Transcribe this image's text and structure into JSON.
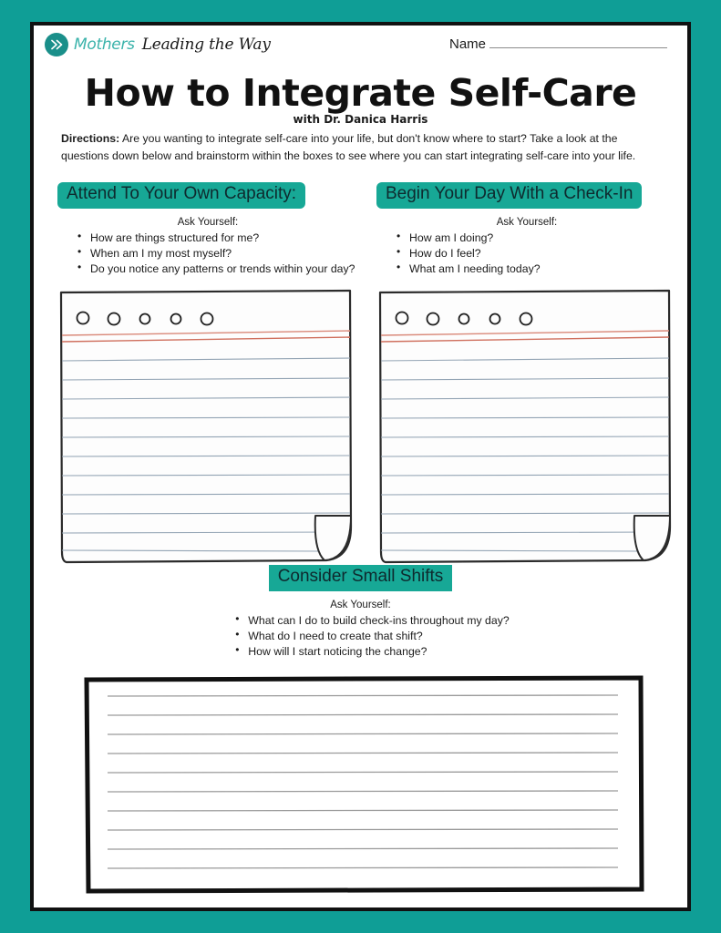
{
  "page": {
    "border_color": "#0f9e96",
    "accent_color": "#17a896",
    "text_color": "#1b1b1b"
  },
  "brand": {
    "logo_icon": "double-chevron-right-icon",
    "word_1": "Mothers",
    "word_2": "Leading the Way",
    "word_1_color": "#3bb3ab",
    "word_2_color": "#1b1b1b"
  },
  "name_field": {
    "label": "Name",
    "value": ""
  },
  "header": {
    "title": "How to Integrate Self-Care",
    "subtitle": "with Dr. Danica Harris"
  },
  "directions": {
    "label": "Directions:",
    "body": " Are you wanting to integrate self-care into your life, but don't know where to start? Take a look at the questions down below and brainstorm within the boxes to see where you can start integrating self-care into your life."
  },
  "sections": [
    {
      "id": "attend-to-your-own-capacity",
      "heading": "Attend To Your Own Capacity:",
      "ask_label": "Ask Yourself:",
      "questions": [
        "How are things structured for me?",
        "When am I my most myself?",
        "Do you notice any patterns or trends within your day?"
      ]
    },
    {
      "id": "begin-your-day-with-a-check-in",
      "heading": "Begin Your Day With a Check-In",
      "ask_label": "Ask Yourself:",
      "questions": [
        "How am I doing?",
        "How do I feel?",
        "What am I needing today?"
      ]
    },
    {
      "id": "consider-small-shifts",
      "heading": "Consider Small Shifts",
      "ask_label": "Ask Yourself:",
      "questions": [
        "What can I do to build check-ins throughout my day?",
        " What do I need to create that shift?",
        "How will I start noticing the change?"
      ]
    }
  ],
  "notepads": {
    "hole_count": 5,
    "red_rule_count": 2,
    "ruled_line_count": 11,
    "red_rule_color": "#d98878",
    "ruled_line_color": "#8e9fb0",
    "outline_color": "#2b2b2b"
  },
  "bottom_box": {
    "ruled_line_count": 10,
    "ruled_line_color": "#9a9a9a",
    "outline_color": "#111111"
  }
}
